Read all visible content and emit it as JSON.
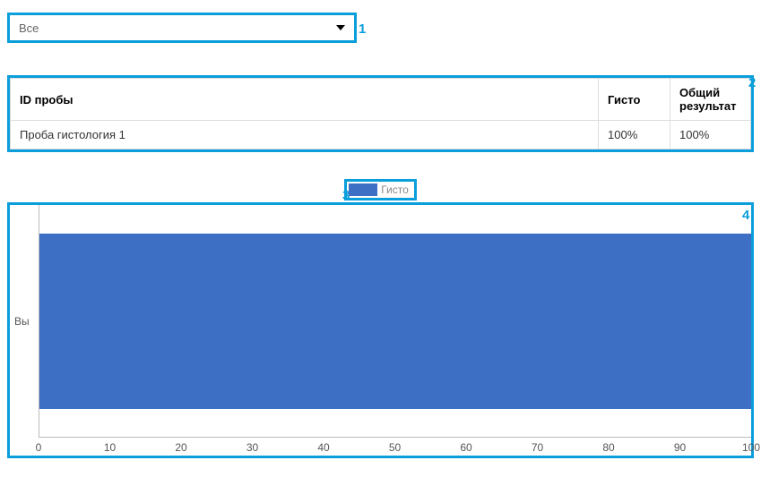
{
  "dropdown": {
    "selected": "Все"
  },
  "callouts": {
    "c1": "1",
    "c2": "2",
    "c3": "3",
    "c4": "4"
  },
  "table": {
    "headers": {
      "id": "ID пробы",
      "gisto": "Гисто",
      "result": "Общий результат"
    },
    "rows": [
      {
        "id": "Проба гистология 1",
        "gisto": "100%",
        "result": "100%"
      }
    ]
  },
  "chart_data": {
    "type": "bar",
    "orientation": "horizontal",
    "categories": [
      "Вы"
    ],
    "series": [
      {
        "name": "Гисто",
        "values": [
          100
        ],
        "color": "#3d6fc4"
      }
    ],
    "xlim": [
      0,
      100
    ],
    "x_ticks": [
      0,
      10,
      20,
      30,
      40,
      50,
      60,
      70,
      80,
      90,
      100
    ],
    "legend": "Гисто",
    "ylabel_text": "Вы"
  }
}
